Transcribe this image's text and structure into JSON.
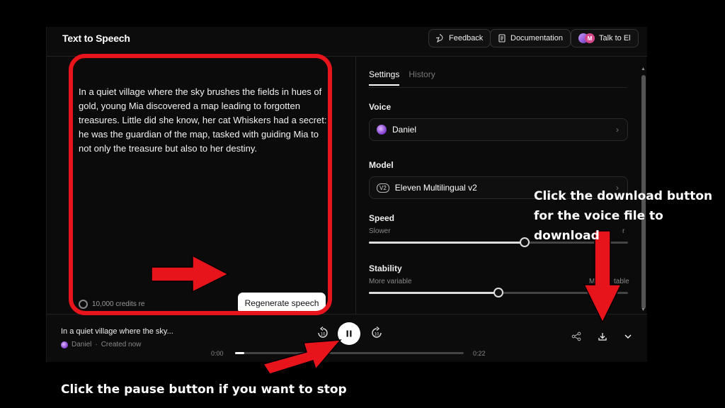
{
  "header": {
    "title": "Text to Speech",
    "feedback_label": "Feedback",
    "documentation_label": "Documentation",
    "talk_label": "Talk to El",
    "avatar_letter": "M"
  },
  "editor": {
    "text": "In a quiet village where the sky brushes the fields in hues of gold, young Mia discovered a map leading to forgotten treasures. Little did she know, her cat Whiskers had a secret: he was the guardian of the map, tasked with guiding Mia to not only the treasure but also to her destiny.",
    "credits_text": "10,000 credits re",
    "regenerate_label": "Regenerate speech"
  },
  "settings": {
    "tabs": [
      {
        "label": "Settings",
        "active": true
      },
      {
        "label": "History",
        "active": false
      }
    ],
    "voice_label": "Voice",
    "voice_value": "Daniel",
    "model_label": "Model",
    "model_badge": "V2",
    "model_value": "Eleven Multilingual v2",
    "speed_label": "Speed",
    "speed_left": "Slower",
    "speed_right": "r",
    "speed_fraction": 0.6,
    "stability_label": "Stability",
    "stability_left": "More variable",
    "stability_right": "M",
    "stability_right2": "table",
    "stability_fraction": 0.5
  },
  "player": {
    "title": "In a quiet village where the sky...",
    "voice": "Daniel",
    "created": "Created now",
    "time_current": "0:00",
    "time_total": "0:22",
    "progress_fraction": 0.04,
    "skip_back_label": "10",
    "skip_fwd_label": "10"
  },
  "annotations": {
    "download_hint": "Click the download button for the voice file to download",
    "pause_hint": "Click the pause button if you want to stop"
  },
  "colors": {
    "highlight_red": "#e8141c",
    "background": "#000000"
  }
}
